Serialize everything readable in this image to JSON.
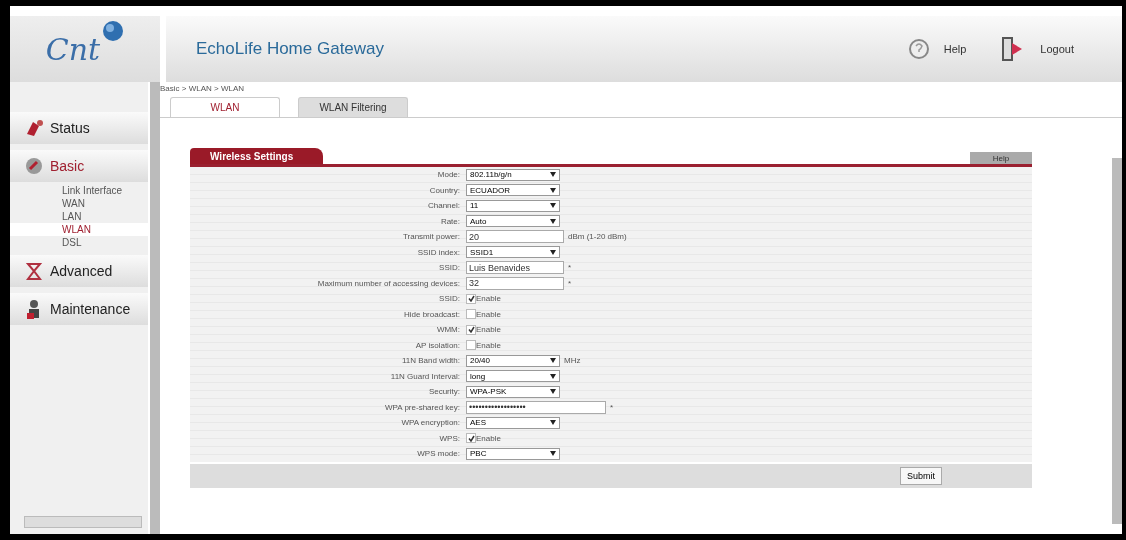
{
  "header": {
    "logo": "Cnt",
    "title": "EchoLife Home Gateway",
    "help": "Help",
    "logout": "Logout"
  },
  "breadcrumb": "Basic > WLAN > WLAN",
  "tabs": [
    {
      "label": "WLAN",
      "selected": true
    },
    {
      "label": "WLAN Filtering",
      "selected": false
    }
  ],
  "sidebar": {
    "items": [
      {
        "label": "Status",
        "selected": false
      },
      {
        "label": "Basic",
        "selected": true,
        "children": [
          {
            "label": "Link Interface",
            "selected": false
          },
          {
            "label": "WAN",
            "selected": false
          },
          {
            "label": "LAN",
            "selected": false
          },
          {
            "label": "WLAN",
            "selected": true
          },
          {
            "label": "DSL",
            "selected": false
          }
        ]
      },
      {
        "label": "Advanced",
        "selected": false
      },
      {
        "label": "Maintenance",
        "selected": false
      }
    ]
  },
  "section": {
    "title": "Wireless Settings",
    "help": "Help"
  },
  "fields": [
    {
      "label": "Mode:",
      "kind": "select",
      "value": "802.11b/g/n"
    },
    {
      "label": "Country:",
      "kind": "select",
      "value": "ECUADOR"
    },
    {
      "label": "Channel:",
      "kind": "select",
      "value": "11"
    },
    {
      "label": "Rate:",
      "kind": "select",
      "value": "Auto"
    },
    {
      "label": "Transmit power:",
      "kind": "text",
      "value": "20",
      "suffix": "dBm (1-20 dBm)"
    },
    {
      "label": "SSID index:",
      "kind": "select",
      "value": "SSID1"
    },
    {
      "label": "SSID:",
      "kind": "text",
      "value": "Luis Benavides",
      "suffix": "*"
    },
    {
      "label": "Maximum number of accessing devices:",
      "kind": "text",
      "value": "32",
      "suffix": "*"
    },
    {
      "label": "SSID:",
      "kind": "checkbox",
      "value": "Enable",
      "checked": true
    },
    {
      "label": "Hide broadcast:",
      "kind": "checkbox",
      "value": "Enable",
      "checked": false
    },
    {
      "label": "WMM:",
      "kind": "checkbox",
      "value": "Enable",
      "checked": true
    },
    {
      "label": "AP isolation:",
      "kind": "checkbox",
      "value": "Enable",
      "checked": false
    },
    {
      "label": "11N Band width:",
      "kind": "select",
      "value": "20/40",
      "suffix": "MHz"
    },
    {
      "label": "11N Guard Interval:",
      "kind": "select",
      "value": "long"
    },
    {
      "label": "Security:",
      "kind": "select",
      "value": "WPA-PSK"
    },
    {
      "label": "WPA pre-shared key:",
      "kind": "password",
      "value": "••••••••••••••••••",
      "suffix": "*"
    },
    {
      "label": "WPA encryption:",
      "kind": "select",
      "value": "AES"
    },
    {
      "label": "WPS:",
      "kind": "checkbox",
      "value": "Enable",
      "checked": true
    },
    {
      "label": "WPS mode:",
      "kind": "select",
      "value": "PBC"
    }
  ],
  "submit": "Submit"
}
